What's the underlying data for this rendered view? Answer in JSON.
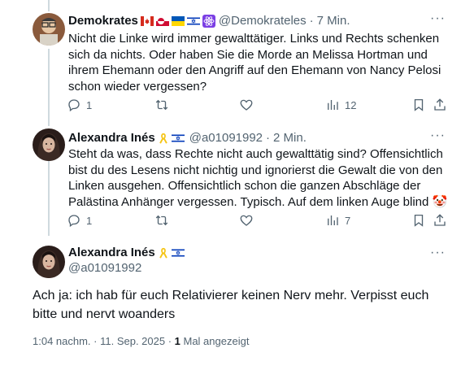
{
  "tweet1": {
    "name": "Demokrates",
    "handle": "@Demokrateles",
    "sep": "·",
    "time": "7 Min.",
    "text": "Nicht die Linke wird immer gewalttätiger. Links und Rechts schenken sich da nichts. Oder haben Sie die Morde an Melissa Hortman und ihrem Ehemann oder den Angriff auf den Ehemann von Nancy Pelosi schon wieder vergessen?",
    "replies": "1",
    "views": "12"
  },
  "tweet2": {
    "name": "Alexandra Inés",
    "handle": "@a01091992",
    "sep": "·",
    "time": "2 Min.",
    "text": "Steht da was, dass Rechte nicht auch gewalttätig sind? Offensichtlich bist du des Lesens nicht nichtig und ignorierst die Gewalt die von den Linken ausgehen. Offensichtlich schon die ganzen Abschläge der Palästina Anhänger vergessen. Typisch. Auf dem linken Auge blind 🤡",
    "replies": "1",
    "views": "7"
  },
  "tweet3": {
    "name": "Alexandra Inés",
    "handle": "@a01091992",
    "text": "Ach ja: ich hab für euch Relativierer keinen Nerv mehr. Verpisst euch bitte und nervt woanders",
    "timestamp": "1:04 nachm. · 11. Sep. 2025 · ",
    "view_count": "1",
    "view_label": " Mal angezeigt"
  },
  "more_icon": "more-horizontal-icon",
  "colors": {
    "text": "#0f1419",
    "muted": "#536471",
    "line": "#cfd9de",
    "ribbon": "#f5c518"
  }
}
